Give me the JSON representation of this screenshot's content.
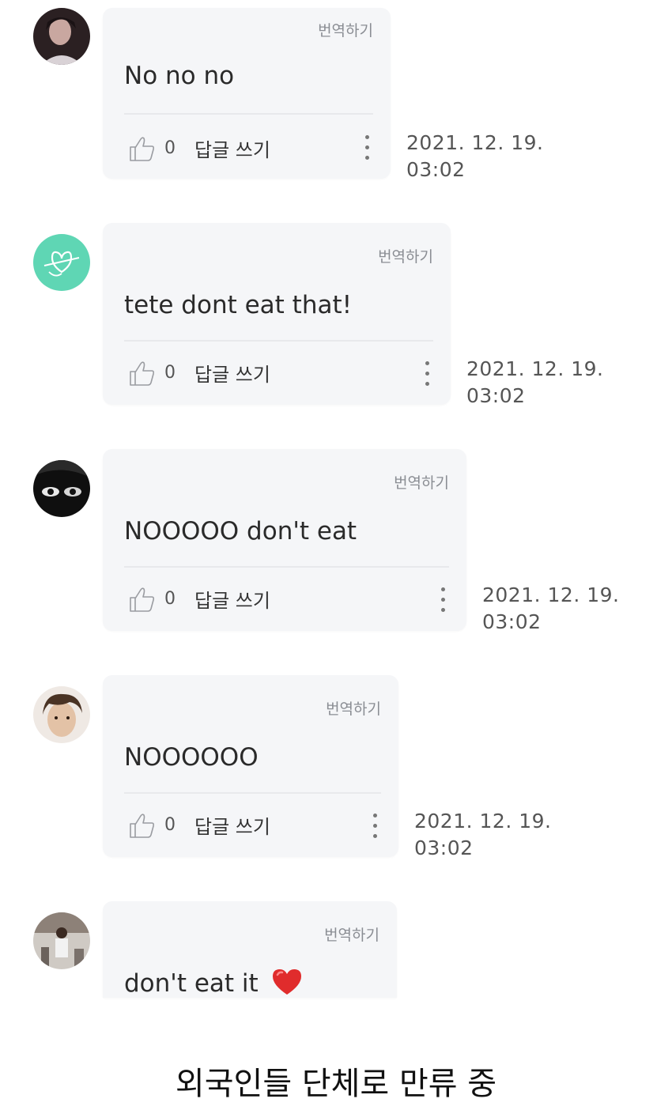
{
  "comments": [
    {
      "translate_label": "번역하기",
      "text": "No no no",
      "like_count": "0",
      "reply_label": "답글 쓰기",
      "date": "2021. 12. 19.",
      "time": "03:02"
    },
    {
      "translate_label": "번역하기",
      "text": "tete dont eat that!",
      "like_count": "0",
      "reply_label": "답글 쓰기",
      "date": "2021. 12. 19.",
      "time": "03:02"
    },
    {
      "translate_label": "번역하기",
      "text": "NOOOOO don't eat",
      "like_count": "0",
      "reply_label": "답글 쓰기",
      "date": "2021. 12. 19.",
      "time": "03:02"
    },
    {
      "translate_label": "번역하기",
      "text": "NOOOOOO",
      "like_count": "0",
      "reply_label": "답글 쓰기",
      "date": "2021. 12. 19.",
      "time": "03:02"
    },
    {
      "translate_label": "번역하기",
      "text": "don't eat it",
      "emoji": "❤️"
    }
  ],
  "caption": "외국인들 단체로 만류 중",
  "colors": {
    "bubble_bg": "#f5f6f8",
    "heart": "#e02c2c",
    "avatar_teal": "#5fd6b4"
  },
  "icons": {
    "like": "thumbs-up-icon",
    "more": "vertical-dots-icon",
    "heart": "heart-emoji"
  }
}
